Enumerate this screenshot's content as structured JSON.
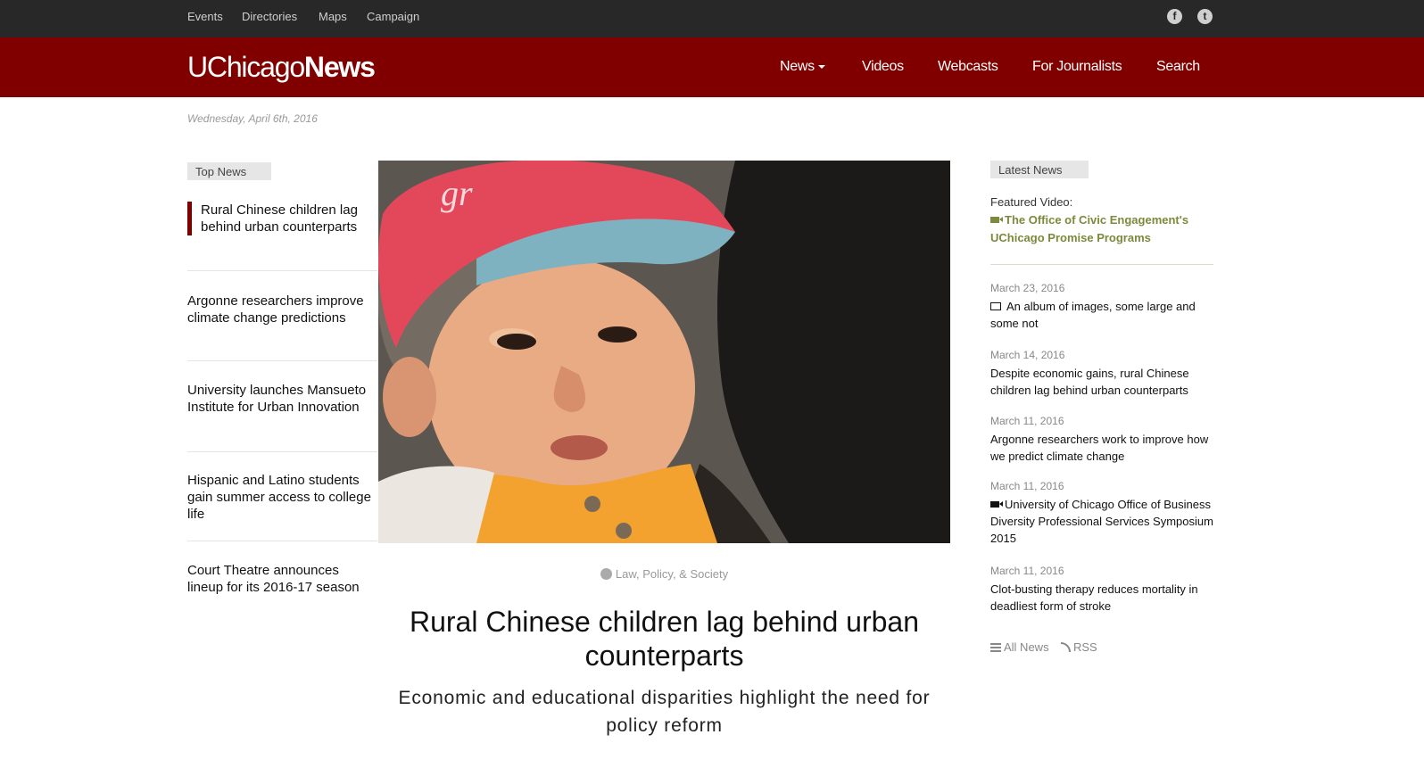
{
  "topbar": {
    "links": [
      "Events",
      "Directories",
      "Maps",
      "Campaign"
    ],
    "social": [
      "facebook-icon",
      "twitter-icon"
    ]
  },
  "header": {
    "logo_light": "UChicago",
    "logo_bold": "News",
    "nav": [
      "News",
      "Videos",
      "Webcasts",
      "For Journalists",
      "Search"
    ]
  },
  "date": "Wednesday, April 6th, 2016",
  "top_news": {
    "label": "Top News",
    "items": [
      "Rural Chinese children lag behind urban counterparts",
      "Argonne researchers improve climate change predictions",
      "University launches Mansueto Institute for Urban Innovation",
      "Hispanic and Latino students gain summer access to college life",
      "Court Theatre announces lineup for its 2016-17 season"
    ]
  },
  "feature": {
    "category": "Law, Policy, & Society",
    "headline": "Rural Chinese children lag behind urban counterparts",
    "subhead": "Economic and educational disparities highlight the need for policy reform"
  },
  "latest_news": {
    "label": "Latest News",
    "featured_label": "Featured Video:",
    "featured_title": "The Office of Civic Engagement's UChicago Promise Programs",
    "items": [
      {
        "date": "March 23, 2016",
        "title": "An album of images, some large and some not",
        "icon": "image-icon"
      },
      {
        "date": "March 14, 2016",
        "title": "Despite economic gains, rural Chinese children lag behind urban counterparts",
        "icon": ""
      },
      {
        "date": "March 11, 2016",
        "title": "Argonne researchers work to improve how we predict climate change",
        "icon": ""
      },
      {
        "date": "March 11, 2016",
        "title": "University of Chicago Office of Business Diversity Professional Services Symposium 2015",
        "icon": "video-icon"
      },
      {
        "date": "March 11, 2016",
        "title": "Clot-busting therapy reduces mortality in deadliest form of stroke",
        "icon": ""
      }
    ],
    "all_news": "All News",
    "rss": "RSS"
  },
  "colors": {
    "brand": "#800000",
    "topbar": "#282828",
    "featured_link": "#7b8a3b"
  }
}
